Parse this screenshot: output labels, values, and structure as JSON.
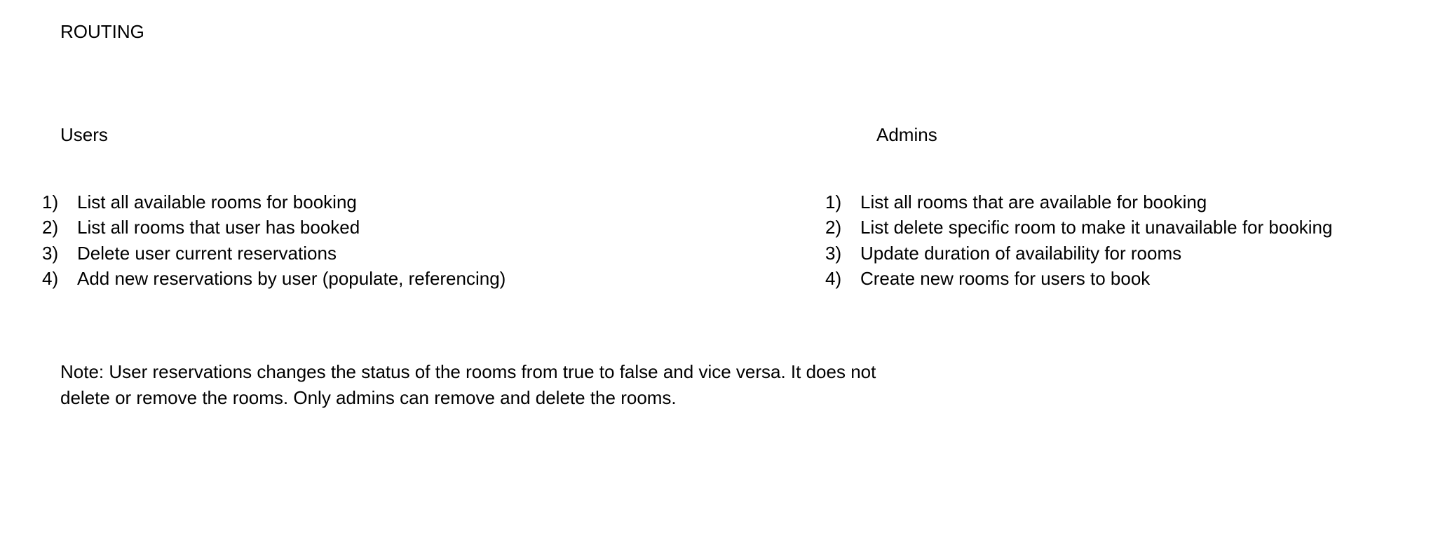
{
  "document": {
    "title": "ROUTING",
    "users": {
      "heading": "Users",
      "items": [
        {
          "num": "1)",
          "text": "List all available rooms for booking"
        },
        {
          "num": "2)",
          "text": "List all rooms that user has booked"
        },
        {
          "num": "3)",
          "text": "Delete user current reservations"
        },
        {
          "num": "4)",
          "text": "Add new reservations by user (populate, referencing)"
        }
      ]
    },
    "admins": {
      "heading": "Admins",
      "items": [
        {
          "num": "1)",
          "text": "List all rooms that are available for booking"
        },
        {
          "num": "2)",
          "text": "List delete specific room to make it unavailable for booking"
        },
        {
          "num": "3)",
          "text": "Update duration of availability for rooms"
        },
        {
          "num": "4)",
          "text": "Create new rooms for users to book"
        }
      ]
    },
    "note": {
      "line1": "Note: User reservations changes the status of the rooms from true to false and vice versa. It does not",
      "line2": "delete or remove the rooms. Only admins can remove and delete the rooms."
    }
  }
}
